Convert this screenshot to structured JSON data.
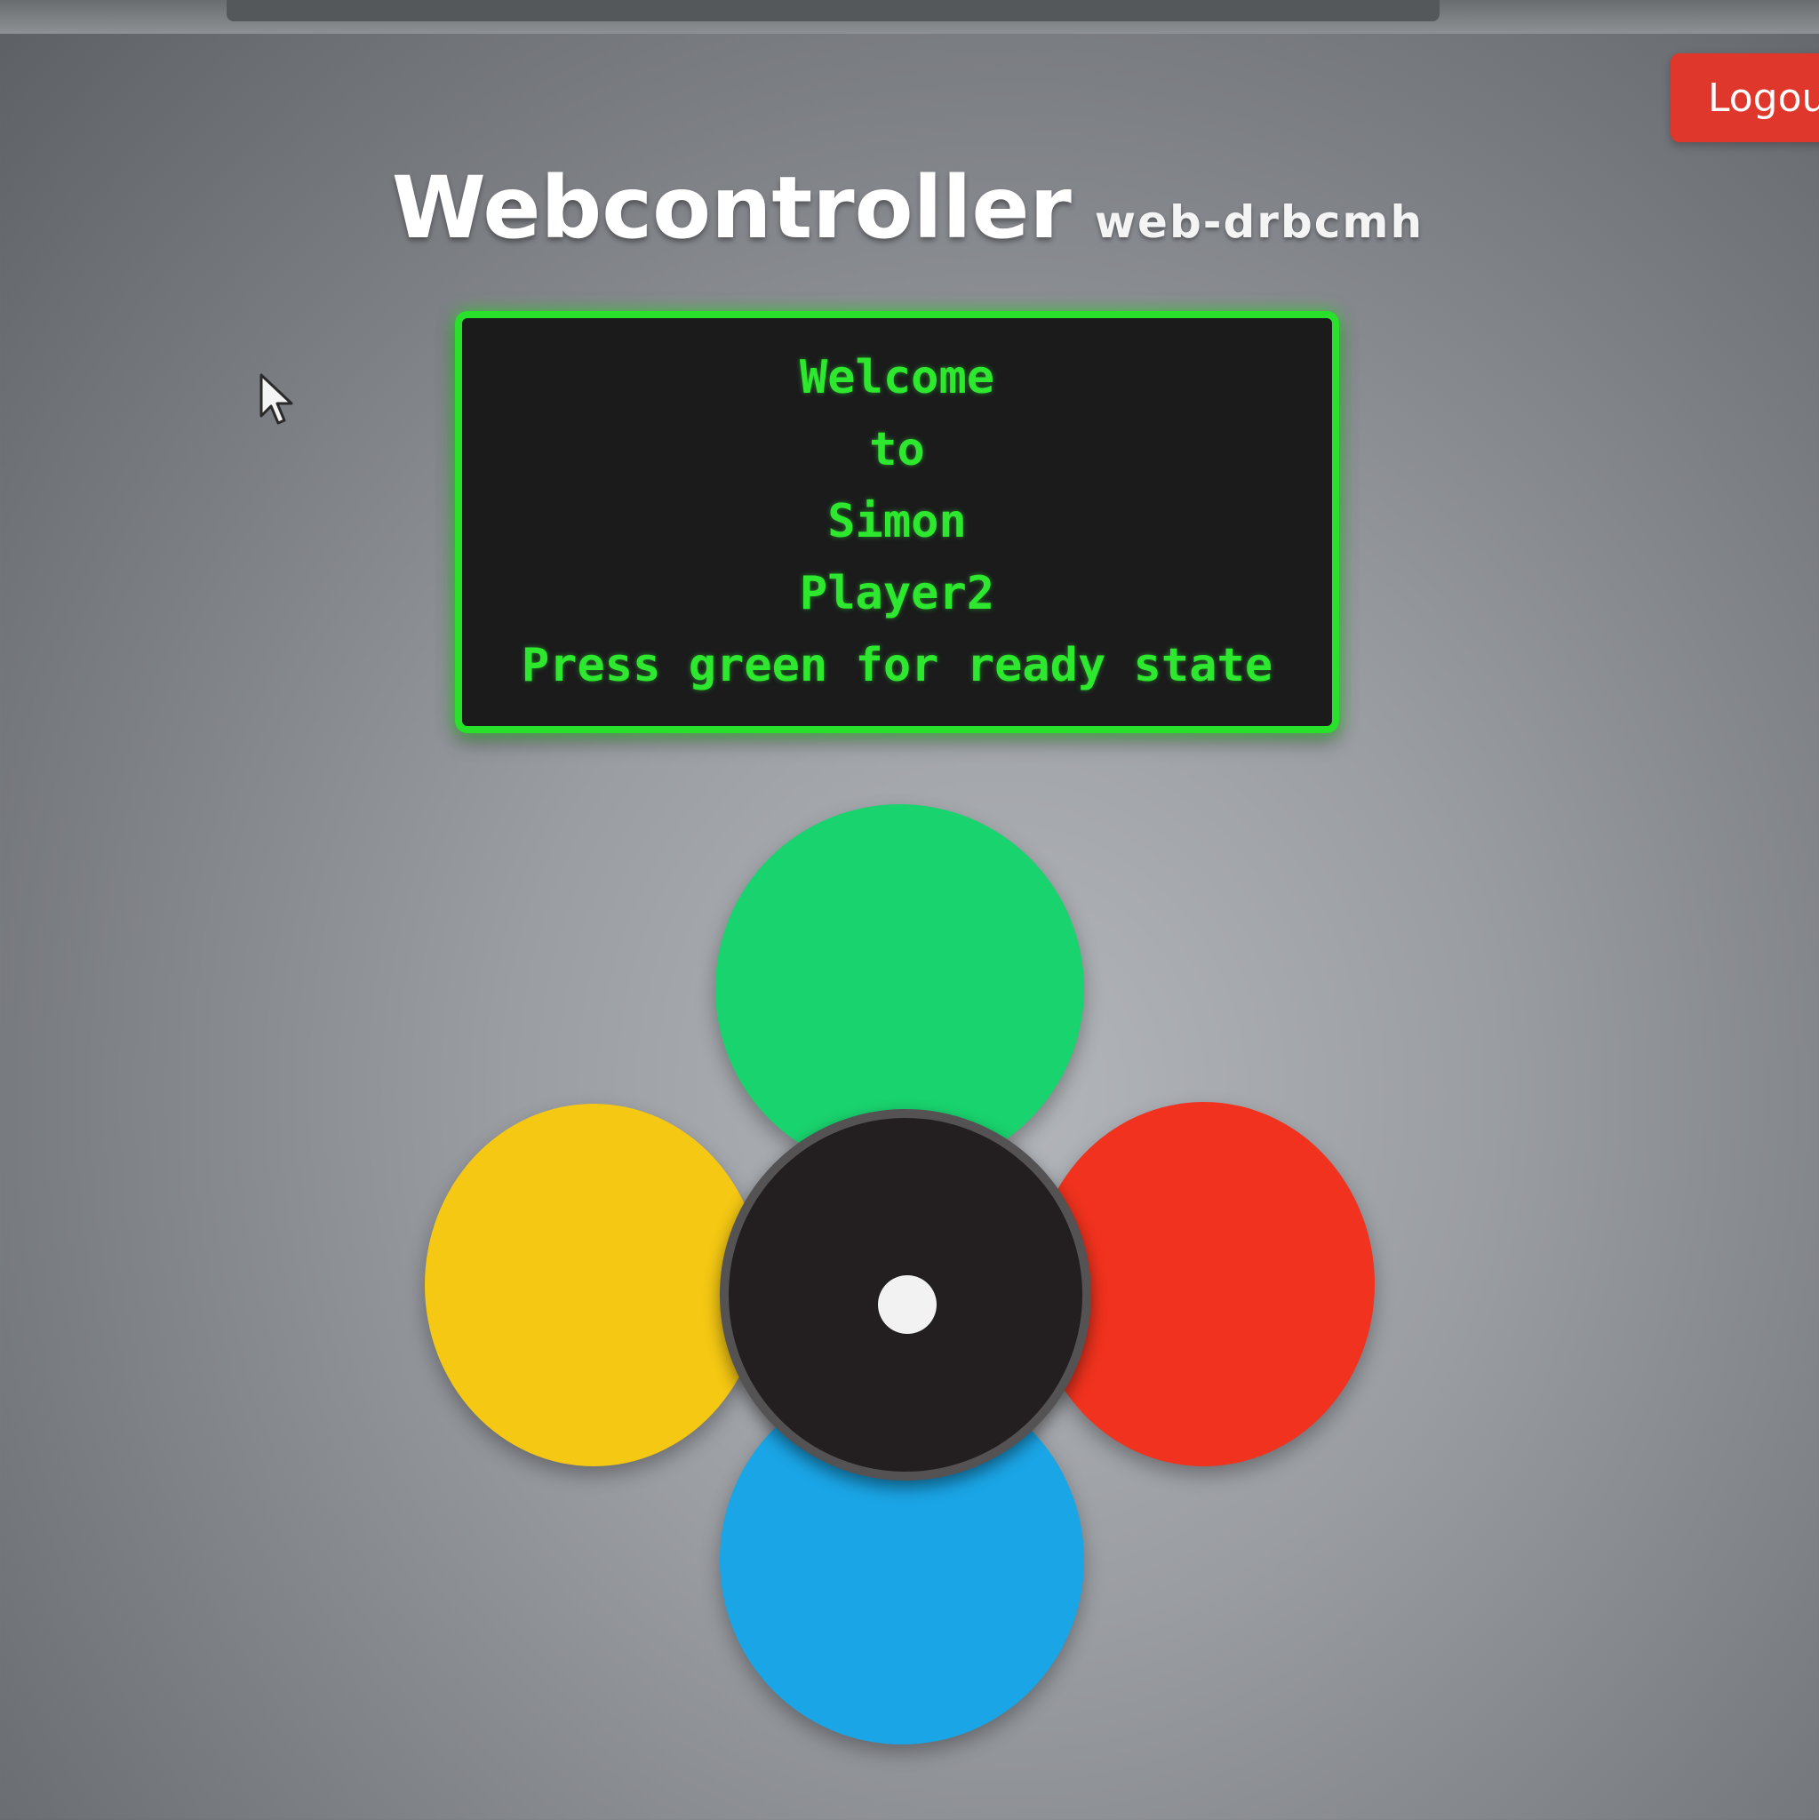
{
  "header": {
    "title": "Webcontroller",
    "subtitle": "web-drbcmh",
    "logout_label": "Logout"
  },
  "display": {
    "lines": [
      "Welcome",
      "to",
      "Simon",
      "Player2",
      "Press green for ready state"
    ],
    "border_color": "#29e02a",
    "text_color": "#2ee830"
  },
  "controller": {
    "buttons": [
      {
        "color_name": "green",
        "color": "#19d36e"
      },
      {
        "color_name": "yellow",
        "color": "#f5c814"
      },
      {
        "color_name": "red",
        "color": "#f0321e"
      },
      {
        "color_name": "blue",
        "color": "#1aa5e6"
      }
    ],
    "hub_color": "#231f20",
    "dot_color": "#f2f2f2"
  },
  "icons": {
    "cursor": "mouse-pointer-icon"
  }
}
